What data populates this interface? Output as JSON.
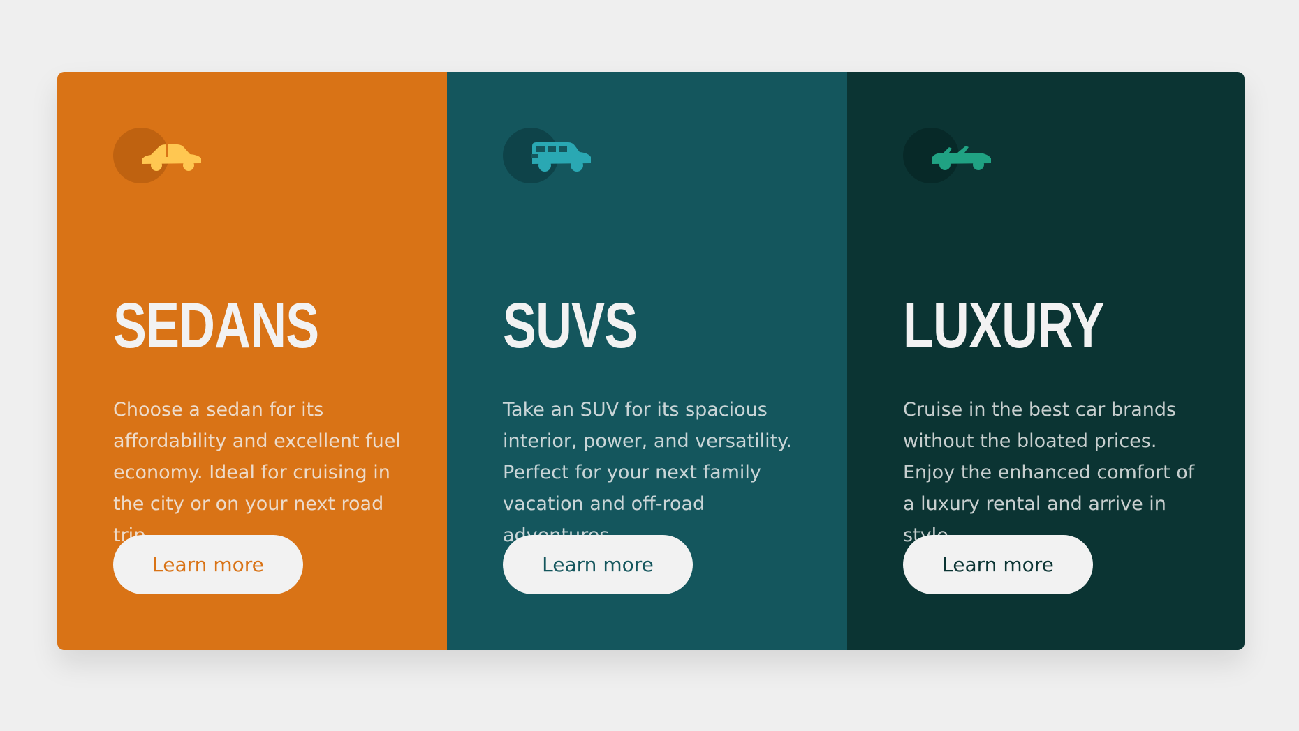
{
  "cards": [
    {
      "title": "SEDANS",
      "description": "Choose a sedan for its affordability and excellent fuel economy. Ideal for cruising in the city or on your next road trip.",
      "button_label": "Learn more",
      "icon": "sedan-icon",
      "colors": {
        "background": "#d97316",
        "icon": "#ffc751",
        "icon_circle": "#a9540d",
        "button_text": "#d97316"
      }
    },
    {
      "title": "SUVS",
      "description": "Take an SUV for its spacious interior, power, and versatility. Perfect for your next family vacation and off-road adventures.",
      "button_label": "Learn more",
      "icon": "suv-icon",
      "colors": {
        "background": "#14565d",
        "icon": "#2aa8b3",
        "icon_circle": "#0a3539",
        "button_text": "#14565d"
      }
    },
    {
      "title": "LUXURY",
      "description": "Cruise in the best car brands without the bloated prices. Enjoy the enhanced comfort of a luxury rental and arrive in style.",
      "button_label": "Learn more",
      "icon": "convertible-icon",
      "colors": {
        "background": "#0b3433",
        "icon": "#20a283",
        "icon_circle": "#06201f",
        "button_text": "#0b3433"
      }
    }
  ]
}
